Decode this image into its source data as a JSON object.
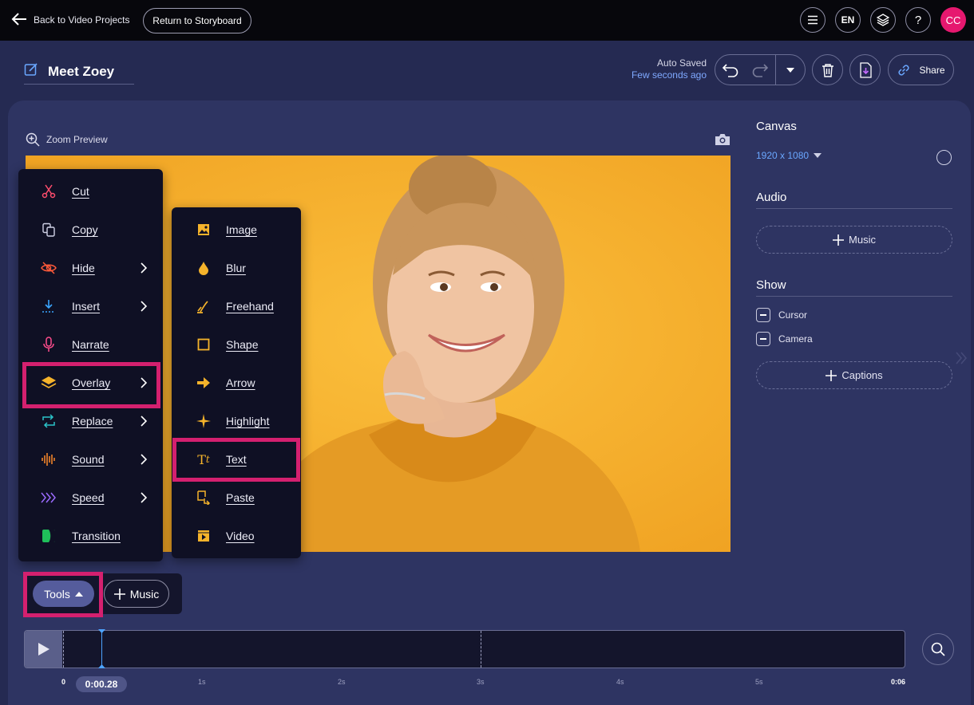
{
  "topbar": {
    "back_label": "Back to Video Projects",
    "storyboard_label": "Return to Storyboard",
    "language": "EN",
    "help": "?",
    "avatar_initials": "CC"
  },
  "project": {
    "title": "Meet Zoey",
    "autosave_label": "Auto Saved",
    "autosave_time": "Few seconds ago",
    "share_label": "Share"
  },
  "preview": {
    "zoom_label": "Zoom Preview"
  },
  "right_panel": {
    "canvas_heading": "Canvas",
    "canvas_size": "1920 x 1080",
    "audio_heading": "Audio",
    "audio_music_label": "Music",
    "show_heading": "Show",
    "show_items": [
      "Cursor",
      "Camera"
    ],
    "captions_label": "Captions"
  },
  "tools_menu": {
    "items": [
      {
        "label": "Cut",
        "icon": "scissors-icon"
      },
      {
        "label": "Copy",
        "icon": "copy-icon"
      },
      {
        "label": "Hide",
        "icon": "eye-slash-icon"
      },
      {
        "label": "Insert",
        "icon": "insert-icon"
      },
      {
        "label": "Narrate",
        "icon": "microphone-icon"
      },
      {
        "label": "Overlay",
        "icon": "layers-icon"
      },
      {
        "label": "Replace",
        "icon": "replace-icon"
      },
      {
        "label": "Sound",
        "icon": "waveform-icon"
      },
      {
        "label": "Speed",
        "icon": "speed-icon"
      },
      {
        "label": "Transition",
        "icon": "transition-icon"
      }
    ]
  },
  "overlay_menu": {
    "items": [
      {
        "label": "Image",
        "icon": "image-icon"
      },
      {
        "label": "Blur",
        "icon": "droplet-icon"
      },
      {
        "label": "Freehand",
        "icon": "pen-icon"
      },
      {
        "label": "Shape",
        "icon": "square-icon"
      },
      {
        "label": "Arrow",
        "icon": "arrow-right-icon"
      },
      {
        "label": "Highlight",
        "icon": "sparkle-icon"
      },
      {
        "label": "Text",
        "icon": "text-icon"
      },
      {
        "label": "Paste",
        "icon": "paste-icon"
      },
      {
        "label": "Video",
        "icon": "video-icon"
      }
    ]
  },
  "toolbar": {
    "tools_label": "Tools",
    "music_label": "Music"
  },
  "timeline": {
    "current_time": "0:00.28",
    "ticks": [
      "0",
      "1s",
      "2s",
      "3s",
      "4s",
      "5s",
      "0:06"
    ]
  },
  "colors": {
    "accent": "#d4206f",
    "link": "#7fa9ff",
    "panel": "#2e3462",
    "menu_bg": "#0f1024",
    "video_bg": "#f5ae2e"
  }
}
